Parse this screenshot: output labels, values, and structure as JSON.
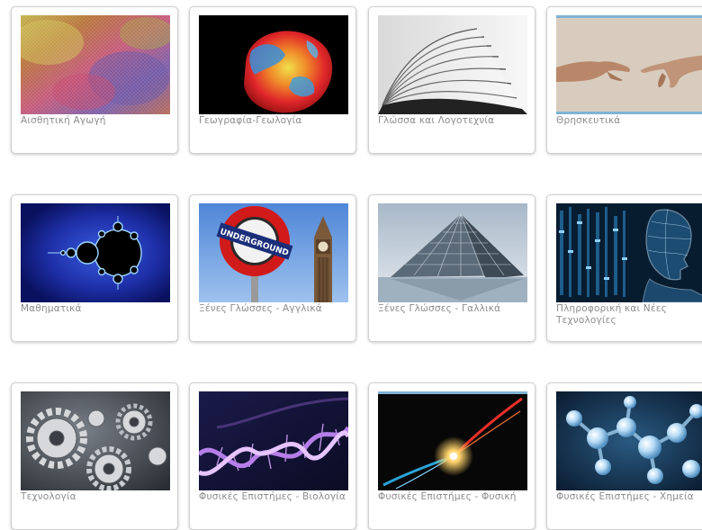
{
  "subjects": [
    {
      "label": "Αισθητική Αγωγή",
      "icon": "art-texture-icon"
    },
    {
      "label": "Γεωγραφία-Γεωλογία",
      "icon": "globe-icon"
    },
    {
      "label": "Γλώσσα και Λογοτεχνία",
      "icon": "open-book-icon"
    },
    {
      "label": "Θρησκευτικά",
      "icon": "creation-of-adam-icon"
    },
    {
      "label": "Μαθηματικά",
      "icon": "mandelbrot-fractal-icon"
    },
    {
      "label": "Ξένες Γλώσσες - Αγγλικά",
      "icon": "london-underground-sign-icon"
    },
    {
      "label": "Ξένες Γλώσσες - Γαλλικά",
      "icon": "louvre-pyramid-icon"
    },
    {
      "label": "Πληροφορική και Νέες Τεχνολογίες",
      "icon": "digital-human-icon"
    },
    {
      "label": "Τεχνολογία",
      "icon": "gears-icon"
    },
    {
      "label": "Φυσικές Επιστήμες - Βιολογία",
      "icon": "dna-helix-icon"
    },
    {
      "label": "Φυσικές Επιστήμες - Φυσική",
      "icon": "particle-collision-icon"
    },
    {
      "label": "Φυσικές Επιστήμες - Χημεία",
      "icon": "molecule-icon"
    }
  ]
}
